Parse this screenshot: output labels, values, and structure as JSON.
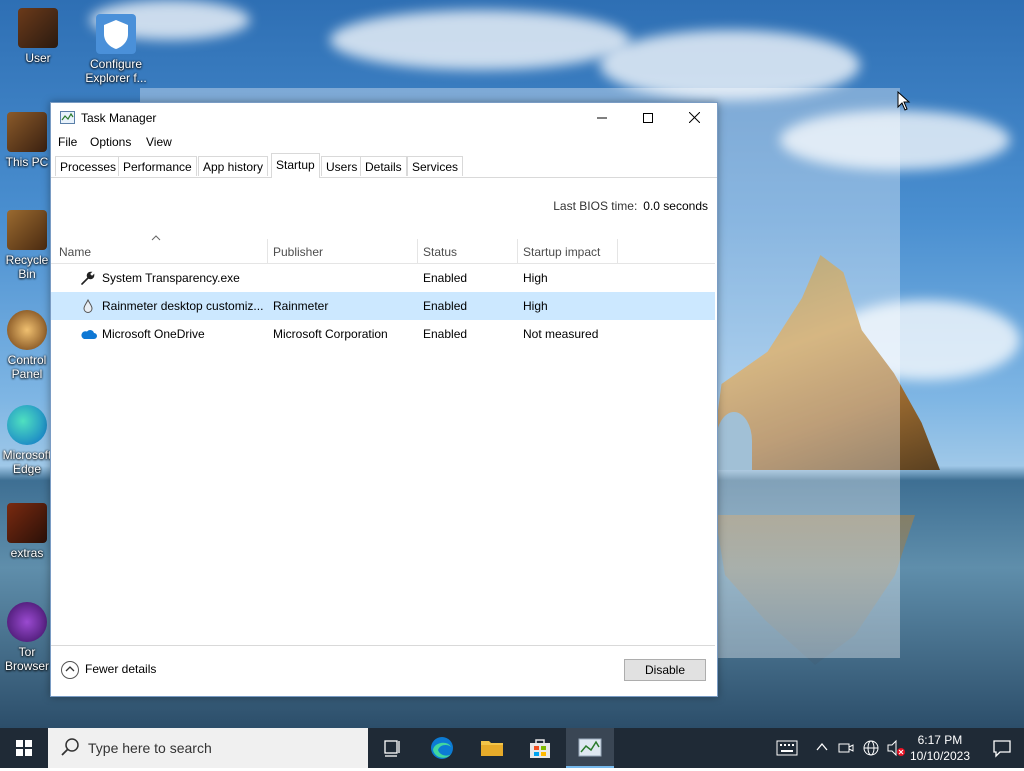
{
  "desktop": {
    "icons": [
      {
        "label": "User"
      },
      {
        "label": "Configure Explorer f..."
      },
      {
        "label": "This PC"
      },
      {
        "label": "Recycle Bin"
      },
      {
        "label": "Control Panel"
      },
      {
        "label": "Microsoft Edge"
      },
      {
        "label": "extras"
      },
      {
        "label": "Tor Browser"
      }
    ]
  },
  "window": {
    "title": "Task Manager",
    "controls": {
      "minimize": "—",
      "maximize": "☐",
      "close": "✕"
    }
  },
  "menu": {
    "file": "File",
    "options": "Options",
    "view": "View"
  },
  "tabs": [
    {
      "label": "Processes"
    },
    {
      "label": "Performance"
    },
    {
      "label": "App history"
    },
    {
      "label": "Startup"
    },
    {
      "label": "Users"
    },
    {
      "label": "Details"
    },
    {
      "label": "Services"
    }
  ],
  "active_tab": "Startup",
  "bios": {
    "label": "Last BIOS time:",
    "value": "0.0 seconds"
  },
  "columns": {
    "name": "Name",
    "publisher": "Publisher",
    "status": "Status",
    "impact": "Startup impact"
  },
  "rows": [
    {
      "name": "System Transparency.exe",
      "publisher": "",
      "status": "Enabled",
      "impact": "High",
      "icon": "wrench-icon"
    },
    {
      "name": "Rainmeter desktop customiz...",
      "publisher": "Rainmeter",
      "status": "Enabled",
      "impact": "High",
      "icon": "rainmeter-icon",
      "selected": true
    },
    {
      "name": "Microsoft OneDrive",
      "publisher": "Microsoft Corporation",
      "status": "Enabled",
      "impact": "Not measured",
      "icon": "onedrive-icon"
    }
  ],
  "footer": {
    "fewer_details": "Fewer details",
    "disable": "Disable"
  },
  "taskbar": {
    "search_placeholder": "Type here to search",
    "time": "6:17 PM",
    "date": "10/10/2023"
  },
  "colors": {
    "selection": "#cce8ff",
    "taskbar": "#1f2a36",
    "accent": "#76b9ed"
  }
}
